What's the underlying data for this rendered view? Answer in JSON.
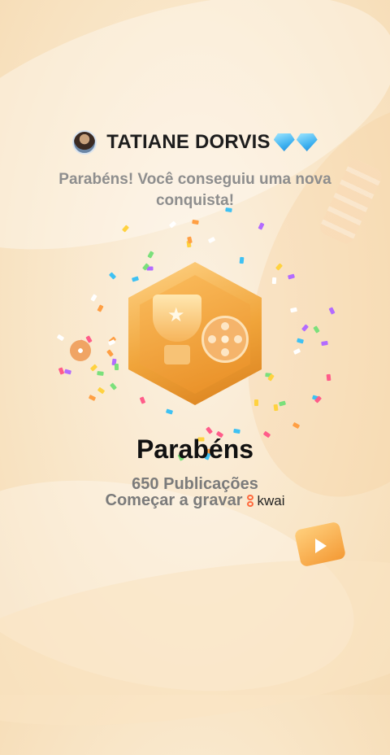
{
  "header": {
    "username": "TATIANE DORVIS",
    "avatar_icon": "avatar",
    "badge_icons": [
      "diamond-icon",
      "diamond-icon"
    ]
  },
  "subtitle": "Parabéns! Você conseguiu uma nova conquista!",
  "badge": {
    "icon": "trophy-film-reel-badge"
  },
  "title": "Parabéns",
  "count_text": "650 Publicações",
  "record_text": "Começar a gravar",
  "brand": {
    "logo_text": "kwai"
  },
  "colors": {
    "background": "#f9e6c8",
    "badge_gold": "#f0a43a",
    "title_text": "#111111",
    "secondary_text": "#7b7b7b",
    "diamond": "#3fb2f0",
    "kwai_accent": "#ff6a3d"
  }
}
